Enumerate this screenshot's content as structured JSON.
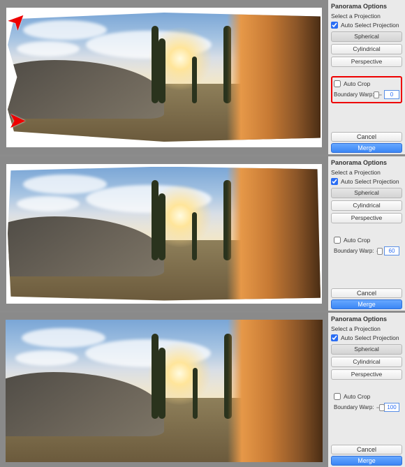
{
  "panels": [
    {
      "title": "Panorama Options",
      "select_label": "Select a Projection",
      "auto_select_checked": true,
      "auto_select_label": "Auto Select Projection",
      "buttons": {
        "spherical": "Spherical",
        "cylindrical": "Cylindrical",
        "perspective": "Perspective"
      },
      "auto_crop_checked": false,
      "auto_crop_label": "Auto Crop",
      "warp_label": "Boundary Warp:",
      "warp_value": "0",
      "warp_pct": 0,
      "highlight_crop": true,
      "cancel": "Cancel",
      "merge": "Merge",
      "arrows": true
    },
    {
      "title": "Panorama Options",
      "select_label": "Select a Projection",
      "auto_select_checked": true,
      "auto_select_label": "Auto Select Projection",
      "buttons": {
        "spherical": "Spherical",
        "cylindrical": "Cylindrical",
        "perspective": "Perspective"
      },
      "auto_crop_checked": false,
      "auto_crop_label": "Auto Crop",
      "warp_label": "Boundary Warp:",
      "warp_value": "60",
      "warp_pct": 60,
      "highlight_crop": false,
      "cancel": "Cancel",
      "merge": "Merge",
      "arrows": false
    },
    {
      "title": "Panorama Options",
      "select_label": "Select a Projection",
      "auto_select_checked": true,
      "auto_select_label": "Auto Select Projection",
      "buttons": {
        "spherical": "Spherical",
        "cylindrical": "Cylindrical",
        "perspective": "Perspective"
      },
      "auto_crop_checked": false,
      "auto_crop_label": "Auto Crop",
      "warp_label": "Boundary Warp:",
      "warp_value": "100",
      "warp_pct": 100,
      "highlight_crop": false,
      "cancel": "Cancel",
      "merge": "Merge",
      "arrows": false
    }
  ]
}
